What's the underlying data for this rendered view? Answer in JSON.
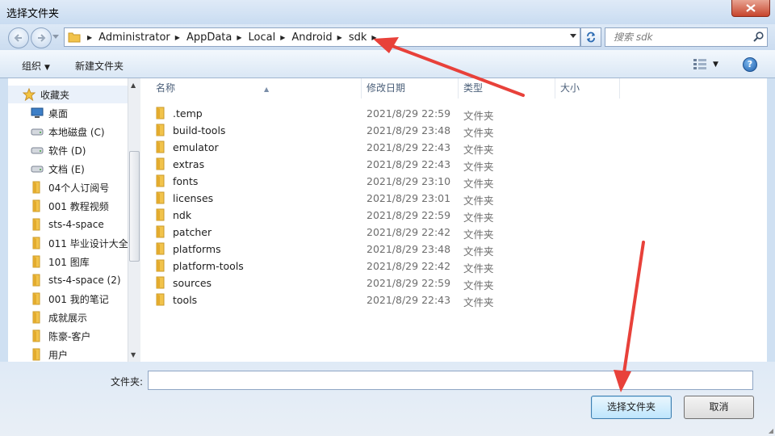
{
  "window": {
    "title": "选择文件夹"
  },
  "address": {
    "crumbs": [
      "Administrator",
      "AppData",
      "Local",
      "Android",
      "sdk"
    ],
    "search_placeholder": "搜索 sdk"
  },
  "toolbar": {
    "organize_label": "组织",
    "new_folder_label": "新建文件夹",
    "help_label": "?"
  },
  "nav": {
    "favorites_label": "收藏夹",
    "items": [
      {
        "label": "桌面",
        "icon": "desktop-icon"
      },
      {
        "label": "本地磁盘 (C)",
        "icon": "drive-icon"
      },
      {
        "label": "软件 (D)",
        "icon": "drive-icon"
      },
      {
        "label": "文档 (E)",
        "icon": "drive-icon"
      },
      {
        "label": "04个人订阅号",
        "icon": "folder-icon"
      },
      {
        "label": "001 教程视频",
        "icon": "folder-icon"
      },
      {
        "label": "sts-4-space",
        "icon": "folder-icon"
      },
      {
        "label": "011 毕业设计大全",
        "icon": "folder-icon"
      },
      {
        "label": "101 图库",
        "icon": "folder-icon"
      },
      {
        "label": "sts-4-space (2)",
        "icon": "folder-icon"
      },
      {
        "label": "001 我的笔记",
        "icon": "folder-icon"
      },
      {
        "label": "成就展示",
        "icon": "folder-icon"
      },
      {
        "label": "陈豪-客户",
        "icon": "folder-icon"
      },
      {
        "label": "用户",
        "icon": "folder-icon"
      }
    ]
  },
  "columns": {
    "name": "名称",
    "date": "修改日期",
    "type": "类型",
    "size": "大小"
  },
  "files": [
    {
      "name": ".temp",
      "date": "2021/8/29 22:59",
      "type": "文件夹"
    },
    {
      "name": "build-tools",
      "date": "2021/8/29 23:48",
      "type": "文件夹"
    },
    {
      "name": "emulator",
      "date": "2021/8/29 22:43",
      "type": "文件夹"
    },
    {
      "name": "extras",
      "date": "2021/8/29 22:43",
      "type": "文件夹"
    },
    {
      "name": "fonts",
      "date": "2021/8/29 23:10",
      "type": "文件夹"
    },
    {
      "name": "licenses",
      "date": "2021/8/29 23:01",
      "type": "文件夹"
    },
    {
      "name": "ndk",
      "date": "2021/8/29 22:59",
      "type": "文件夹"
    },
    {
      "name": "patcher",
      "date": "2021/8/29 22:42",
      "type": "文件夹"
    },
    {
      "name": "platforms",
      "date": "2021/8/29 23:48",
      "type": "文件夹"
    },
    {
      "name": "platform-tools",
      "date": "2021/8/29 22:42",
      "type": "文件夹"
    },
    {
      "name": "sources",
      "date": "2021/8/29 22:59",
      "type": "文件夹"
    },
    {
      "name": "tools",
      "date": "2021/8/29 22:43",
      "type": "文件夹"
    }
  ],
  "footer": {
    "folder_label": "文件夹:",
    "folder_value": "",
    "select_label": "选择文件夹",
    "cancel_label": "取消"
  },
  "colors": {
    "annotation": "#e8413a",
    "folder": "#f2c34b",
    "header_text": "#4c607a"
  }
}
